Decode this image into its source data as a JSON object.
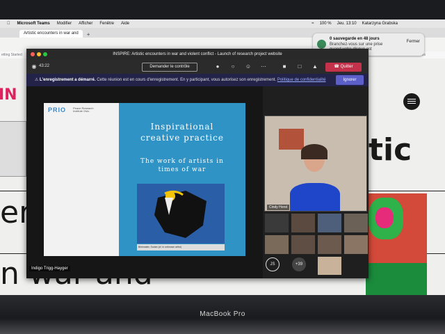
{
  "menubar": {
    "app_name": "Microsoft Teams",
    "menus": [
      "Modifier",
      "Afficher",
      "Fenêtre",
      "Aide"
    ],
    "battery": "100 %",
    "clock": "Jeu. 13:10",
    "user": "Katarzyna Grabska"
  },
  "browser": {
    "tab_title": "Artistic encounters in war and",
    "bookmark_left": "etting Started",
    "bookmark_right": "Other Bookmarks"
  },
  "notification": {
    "title": "0 sauvegarde en 48 jours",
    "body": "Branchez-vous sur une prise quand votre disque est disponible.",
    "button": "Fermer"
  },
  "website": {
    "logo_partial": "IN",
    "big_word_1": "tic",
    "big_word_2": "er",
    "big_word_3": "n war and"
  },
  "teams": {
    "window_title": "INSPIRE: Artistic encounters in war and violent conflict - Launch of research project website",
    "timer": "43:22",
    "control_button": "Demander le contrôle",
    "leave_button": "Quitter",
    "recording": {
      "heading": "L'enregistrement a démarré.",
      "message": "Cette réunion est en cours d'enregistrement. En y participant, vous autorisez son enregistrement.",
      "link": "Politique de confidentialité",
      "ignore_button": "Ignorer"
    },
    "slide": {
      "logo": "PRIO",
      "logo_sub": "Peace Research Institute Oslo",
      "title_line1": "Inspirational",
      "title_line2": "creative practice",
      "subtitle_line1": "The work of artists in",
      "subtitle_line2": "times of war",
      "caption": "Brimwater, Sudan (cf. in unknown artist)"
    },
    "presenter_name": "Indigo Trigg-Hayger",
    "main_participant": "Cindy Horst",
    "participant_initials": "JS",
    "more_count": "+39"
  },
  "laptop": {
    "brand": "MacBook Pro"
  },
  "colors": {
    "leave_red": "#c4314b",
    "teams_purple": "#5b5fc7",
    "slide_blue": "#2f93c6"
  }
}
